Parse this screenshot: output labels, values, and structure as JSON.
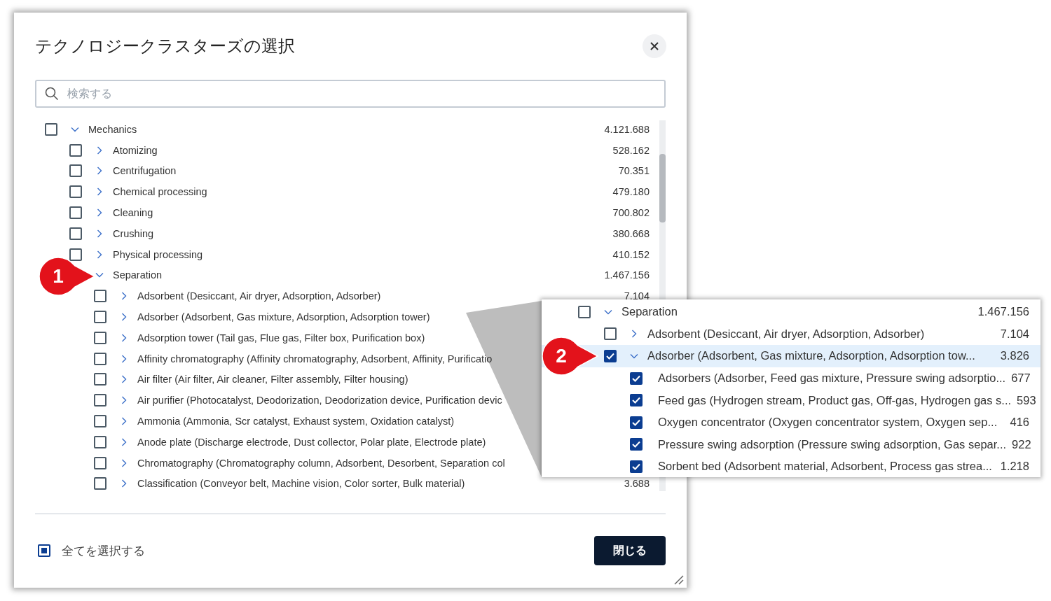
{
  "dialog": {
    "title": "テクノロジークラスターズの選択",
    "search": {
      "placeholder": "検索する"
    },
    "tree": [
      {
        "label": "Mechanics",
        "count": "4.121.688",
        "checked": false,
        "expanded": true,
        "children": [
          {
            "label": "Atomizing",
            "count": "528.162",
            "checked": false,
            "expanded": false
          },
          {
            "label": "Centrifugation",
            "count": "70.351",
            "checked": false,
            "expanded": false
          },
          {
            "label": "Chemical processing",
            "count": "479.180",
            "checked": false,
            "expanded": false
          },
          {
            "label": "Cleaning",
            "count": "700.802",
            "checked": false,
            "expanded": false
          },
          {
            "label": "Crushing",
            "count": "380.668",
            "checked": false,
            "expanded": false
          },
          {
            "label": "Physical processing",
            "count": "410.152",
            "checked": false,
            "expanded": false
          },
          {
            "label": "Separation",
            "count": "1.467.156",
            "checked": false,
            "expanded": true,
            "children": [
              {
                "label": "Adsorbent (Desiccant, Air dryer, Adsorption, Adsorber)",
                "count": "7.104",
                "checked": false,
                "expanded": false
              },
              {
                "label": "Adsorber (Adsorbent, Gas mixture, Adsorption, Adsorption tower)",
                "checked": false,
                "expanded": false
              },
              {
                "label": "Adsorption tower (Tail gas, Flue gas, Filter box, Purification box)",
                "checked": false,
                "expanded": false
              },
              {
                "label": "Affinity chromatography (Affinity chromatography, Adsorbent, Affinity, Purificatio",
                "checked": false,
                "expanded": false
              },
              {
                "label": "Air filter (Air filter, Air cleaner, Filter assembly, Filter housing)",
                "checked": false,
                "expanded": false
              },
              {
                "label": "Air purifier (Photocatalyst, Deodorization, Deodorization device, Purification devic",
                "checked": false,
                "expanded": false
              },
              {
                "label": "Ammonia (Ammonia, Scr catalyst, Exhaust system, Oxidation catalyst)",
                "checked": false,
                "expanded": false
              },
              {
                "label": "Anode plate (Discharge electrode, Dust collector, Polar plate, Electrode plate)",
                "checked": false,
                "expanded": false
              },
              {
                "label": "Chromatography (Chromatography column, Adsorbent, Desorbent, Separation col",
                "checked": false,
                "expanded": false
              },
              {
                "label": "Classification (Conveyor belt, Machine vision, Color sorter, Bulk material)",
                "count": "3.688",
                "checked": false,
                "expanded": false
              }
            ]
          }
        ]
      }
    ],
    "select_all": {
      "label": "全てを選択する",
      "indeterminate": true
    },
    "close_button": "閉じる"
  },
  "inset": {
    "tree": [
      {
        "label": "Separation",
        "count": "1.467.156",
        "checked": false,
        "expanded": true,
        "selected": false,
        "children": [
          {
            "label": "Adsorbent (Desiccant, Air dryer, Adsorption, Adsorber)",
            "count": "7.104",
            "checked": false,
            "expanded": false,
            "selected": false
          },
          {
            "label": "Adsorber (Adsorbent, Gas mixture, Adsorption, Adsorption tow...",
            "count": "3.826",
            "checked": true,
            "expanded": true,
            "selected": true,
            "children": [
              {
                "label": "Adsorbers (Adsorber, Feed gas mixture, Pressure swing adsorptio...",
                "count": "677",
                "checked": true,
                "selected": false
              },
              {
                "label": "Feed gas (Hydrogen stream, Product gas, Off-gas, Hydrogen gas s...",
                "count": "593",
                "checked": true,
                "selected": false
              },
              {
                "label": "Oxygen concentrator (Oxygen concentrator system, Oxygen sep...",
                "count": "416",
                "checked": true,
                "selected": false
              },
              {
                "label": "Pressure swing adsorption (Pressure swing adsorption, Gas separ...",
                "count": "922",
                "checked": true,
                "selected": false
              },
              {
                "label": "Sorbent bed (Adsorbent material, Adsorbent, Process gas strea...",
                "count": "1.218",
                "checked": true,
                "selected": false
              }
            ]
          }
        ]
      }
    ]
  },
  "callouts": [
    {
      "number": "1"
    },
    {
      "number": "2"
    }
  ]
}
